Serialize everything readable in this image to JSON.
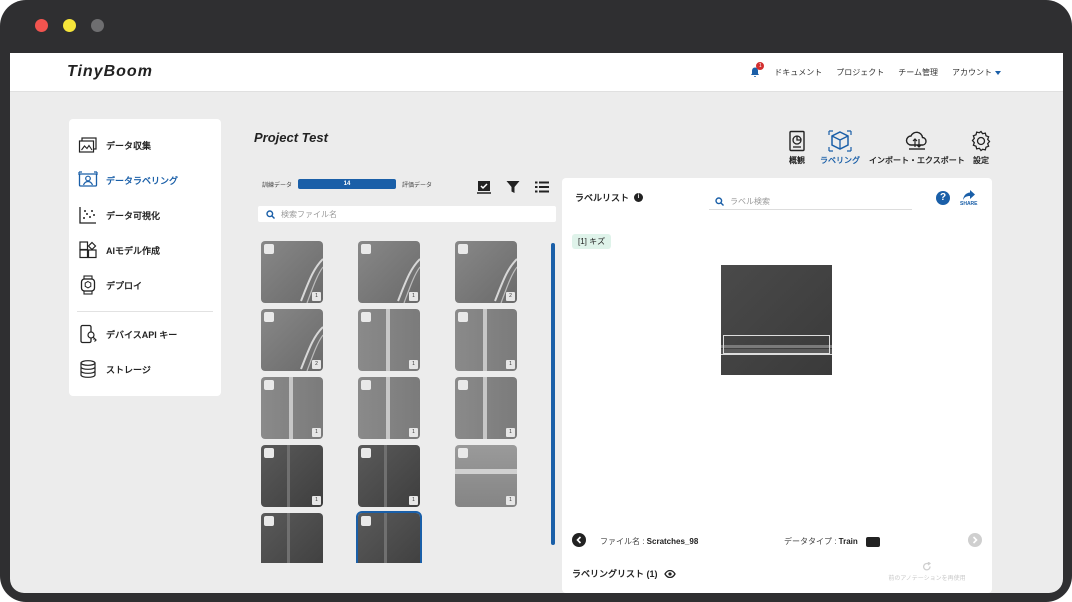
{
  "app": {
    "logo": "TinyBoom",
    "nav": {
      "notifications_count": "1",
      "documents": "ドキュメント",
      "projects": "プロジェクト",
      "team": "チーム管理",
      "account": "アカウント"
    }
  },
  "sidebar": {
    "items": [
      {
        "label": "データ収集",
        "icon": "data-collection-icon"
      },
      {
        "label": "データラベリング",
        "icon": "data-labeling-icon",
        "active": true
      },
      {
        "label": "データ可視化",
        "icon": "scatter-plot-icon"
      },
      {
        "label": "AIモデル作成",
        "icon": "model-blocks-icon"
      },
      {
        "label": "デプロイ",
        "icon": "smartwatch-icon"
      },
      {
        "label": "デバイスAPI キー",
        "icon": "device-key-icon"
      },
      {
        "label": "ストレージ",
        "icon": "database-icon"
      }
    ]
  },
  "project": {
    "title": "Project Test",
    "tools": [
      {
        "label": "概観",
        "icon": "overview-icon"
      },
      {
        "label": "ラベリング",
        "icon": "labeling-box-icon",
        "active": true
      },
      {
        "label": "インポート・エクスポート",
        "icon": "cloud-transfer-icon"
      },
      {
        "label": "設定",
        "icon": "gear-icon"
      }
    ]
  },
  "dataset": {
    "train_label": "訓練データ",
    "eval_label": "評価データ",
    "train_count": "14",
    "search_placeholder": "検索ファイル名",
    "thumbnails": [
      {
        "count": "1",
        "kind": "scratch"
      },
      {
        "count": "1",
        "kind": "scratch"
      },
      {
        "count": "2",
        "kind": "scratch"
      },
      {
        "count": "2",
        "kind": "scratch"
      },
      {
        "count": "1",
        "kind": "line"
      },
      {
        "count": "1",
        "kind": "line"
      },
      {
        "count": "1",
        "kind": "line"
      },
      {
        "count": "1",
        "kind": "line"
      },
      {
        "count": "1",
        "kind": "line"
      },
      {
        "count": "1",
        "kind": "dark"
      },
      {
        "count": "1",
        "kind": "dark"
      },
      {
        "count": "1",
        "kind": "horizontal"
      },
      {
        "count": "",
        "kind": "dark"
      },
      {
        "count": "",
        "kind": "dark",
        "selected": true
      }
    ]
  },
  "labels": {
    "title": "ラベルリスト",
    "search_placeholder": "ラベル検索",
    "share": "SHARE",
    "tag": "[1] キズ",
    "filename_label": "ファイル名 : ",
    "filename": "Scratches_98",
    "datatype_label": "データタイプ : ",
    "datatype": "Train",
    "labeling_list": "ラベリングリスト (1)",
    "reapply": "前のアノテーションを再使用"
  },
  "colors": {
    "accent": "#1a5fa8",
    "tag_bg": "#dff3ea",
    "frame": "#2f2f31"
  }
}
